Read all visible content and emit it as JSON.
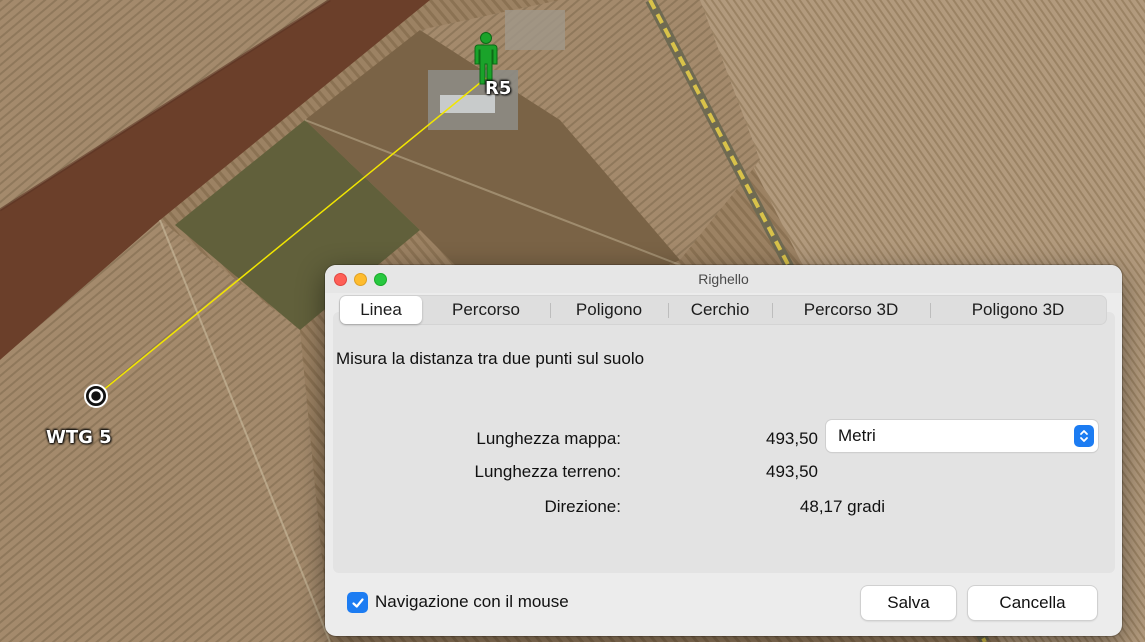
{
  "map": {
    "markers": [
      {
        "label": "R5",
        "icon": "person-icon",
        "color": "#1aa32a"
      },
      {
        "label": "WTG 5",
        "icon": "target-icon"
      }
    ],
    "measure_line_color": "#f2e600"
  },
  "dialog": {
    "title": "Righello",
    "tabs": [
      {
        "label": "Linea",
        "active": true
      },
      {
        "label": "Percorso"
      },
      {
        "label": "Poligono"
      },
      {
        "label": "Cerchio"
      },
      {
        "label": "Percorso 3D"
      },
      {
        "label": "Poligono 3D"
      }
    ],
    "description": "Misura la distanza tra due punti sul suolo",
    "rows": {
      "map_length": {
        "label": "Lunghezza mappa:",
        "value": "493,50"
      },
      "ground_length": {
        "label": "Lunghezza terreno:",
        "value": "493,50"
      },
      "heading": {
        "label": "Direzione:",
        "value": "48,17 gradi"
      }
    },
    "units_select": {
      "value": "Metri"
    },
    "mouse_nav": {
      "label": "Navigazione con il mouse",
      "checked": true
    },
    "buttons": {
      "save": "Salva",
      "clear": "Cancella"
    },
    "accent_color": "#1c7cf2"
  }
}
